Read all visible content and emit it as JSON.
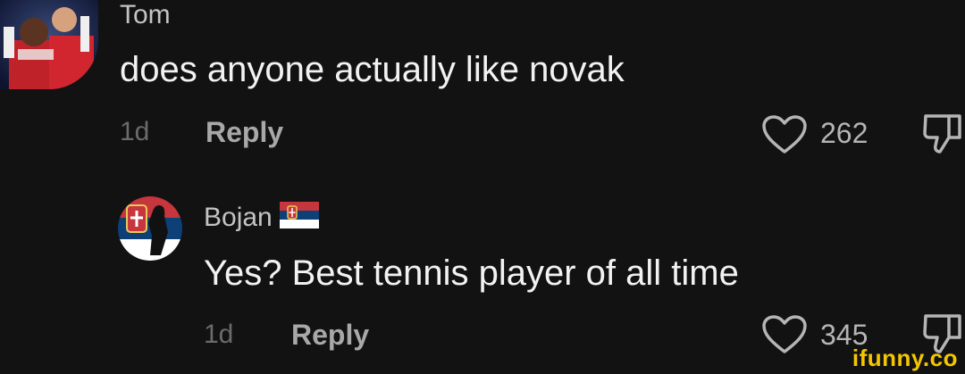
{
  "comments": [
    {
      "username": "Tom",
      "text": "does anyone actually like novak",
      "time": "1d",
      "reply_label": "Reply",
      "likes": "262"
    },
    {
      "username": "Bojan",
      "text": "Yes? Best tennis player of all time",
      "time": "1d",
      "reply_label": "Reply",
      "likes": "345"
    }
  ],
  "icons": {
    "like": "heart-outline-icon",
    "dislike": "thumbs-down-icon",
    "flag": "serbia-flag-icon"
  },
  "watermark": "ifunny.co",
  "colors": {
    "background": "#121212",
    "watermark": "#f4c600"
  }
}
